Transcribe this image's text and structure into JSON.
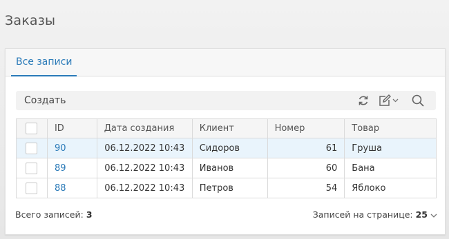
{
  "page": {
    "title": "Заказы"
  },
  "tabs": [
    {
      "label": "Все записи",
      "active": true
    }
  ],
  "toolbar": {
    "create_label": "Создать",
    "icons": [
      "refresh-icon",
      "edit-icon",
      "search-icon"
    ]
  },
  "table": {
    "columns": [
      "ID",
      "Дата создания",
      "Клиент",
      "Номер",
      "Товар"
    ],
    "rows": [
      {
        "id": "90",
        "date": "06.12.2022 10:43",
        "client": "Сидоров",
        "number": "61",
        "product": "Груша",
        "selected": true
      },
      {
        "id": "89",
        "date": "06.12.2022 10:43",
        "client": "Иванов",
        "number": "60",
        "product": "Бана",
        "selected": false
      },
      {
        "id": "88",
        "date": "06.12.2022 10:43",
        "client": "Петров",
        "number": "54",
        "product": "Яблоко",
        "selected": false
      }
    ]
  },
  "footer": {
    "total_label": "Всего записей:",
    "total_value": "3",
    "per_page_label": "Записей на странице:",
    "per_page_value": "25"
  },
  "colors": {
    "accent": "#2a7ab8",
    "selected_row": "#e9f4fc"
  }
}
